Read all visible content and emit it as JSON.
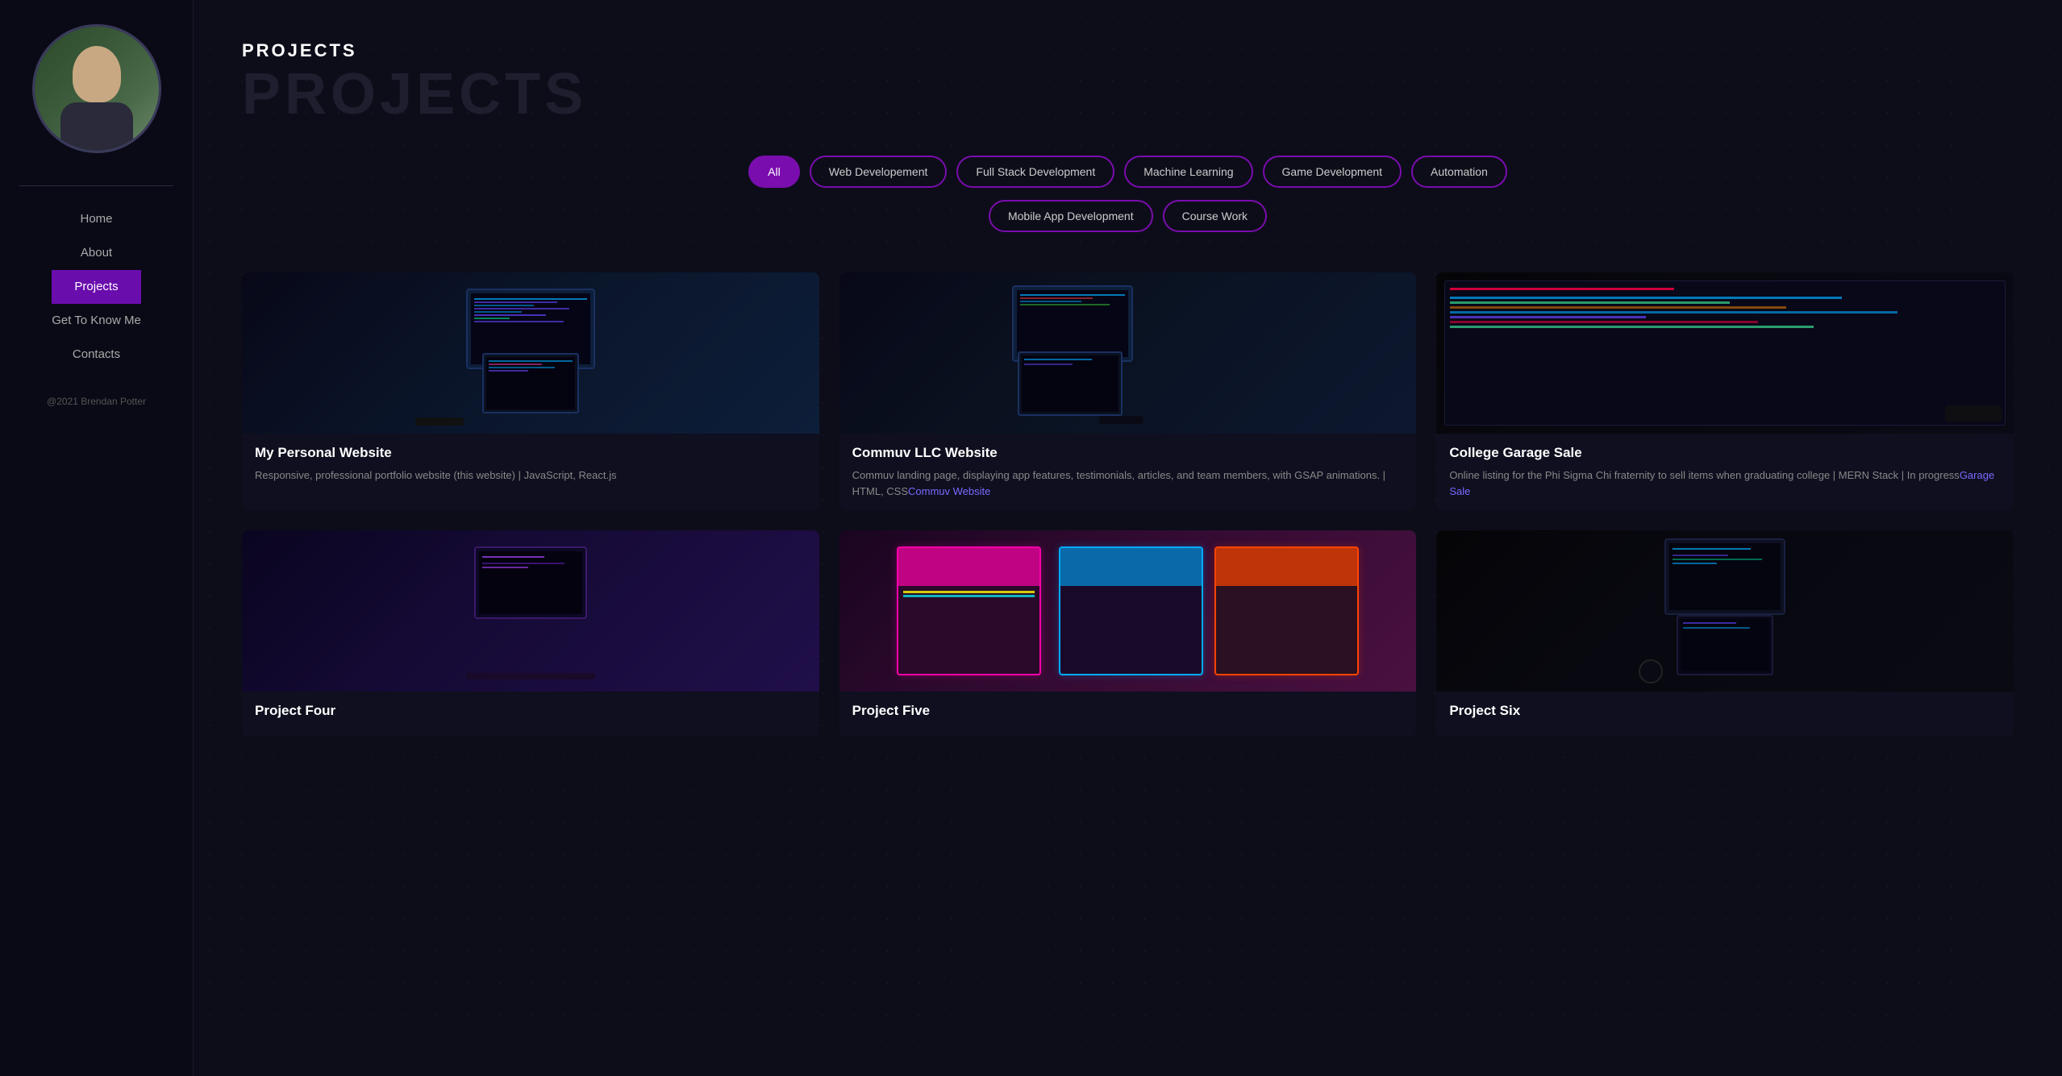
{
  "sidebar": {
    "avatar_alt": "Brendan Potter",
    "nav_items": [
      {
        "label": "Home",
        "href": "#",
        "active": false
      },
      {
        "label": "About",
        "href": "#",
        "active": false
      },
      {
        "label": "Projects",
        "href": "#",
        "active": true
      },
      {
        "label": "Get To Know Me",
        "href": "#",
        "active": false
      },
      {
        "label": "Contacts",
        "href": "#",
        "active": false
      }
    ],
    "footer": "@2021 Brendan Potter"
  },
  "page": {
    "title_small": "PROJECTS",
    "title_large": "PROJECTS"
  },
  "filters": {
    "row1": [
      {
        "label": "All",
        "active": true
      },
      {
        "label": "Web Developement",
        "active": false
      },
      {
        "label": "Full Stack Development",
        "active": false
      },
      {
        "label": "Machine Learning",
        "active": false
      },
      {
        "label": "Game Development",
        "active": false
      },
      {
        "label": "Automation",
        "active": false
      }
    ],
    "row2": [
      {
        "label": "Mobile App Development",
        "active": false
      },
      {
        "label": "Course Work",
        "active": false
      }
    ]
  },
  "projects": [
    {
      "name": "My Personal Website",
      "desc": "Responsive, professional portfolio website (this website) | JavaScript, React.js",
      "link": null,
      "link_text": null,
      "img_type": "coding-desk"
    },
    {
      "name": "Commuv LLC Website",
      "desc": "Commuv landing page, displaying app features, testimonials, articles, and team members, with GSAP animations. | HTML, CSS",
      "link": "#",
      "link_text": "Commuv Website",
      "img_type": "desk-setup"
    },
    {
      "name": "College Garage Sale",
      "desc": "Online listing for the Phi Sigma Chi fraternity to sell items when graduating college | MERN Stack | In progress",
      "link": "#",
      "link_text": "Garage Sale",
      "img_type": "code-screen"
    },
    {
      "name": "Project Four",
      "desc": "",
      "link": null,
      "link_text": null,
      "img_type": "laptop-purple"
    },
    {
      "name": "Project Five",
      "desc": "",
      "link": null,
      "link_text": null,
      "img_type": "arcade"
    },
    {
      "name": "Project Six",
      "desc": "",
      "link": null,
      "link_text": null,
      "img_type": "workspace"
    }
  ]
}
